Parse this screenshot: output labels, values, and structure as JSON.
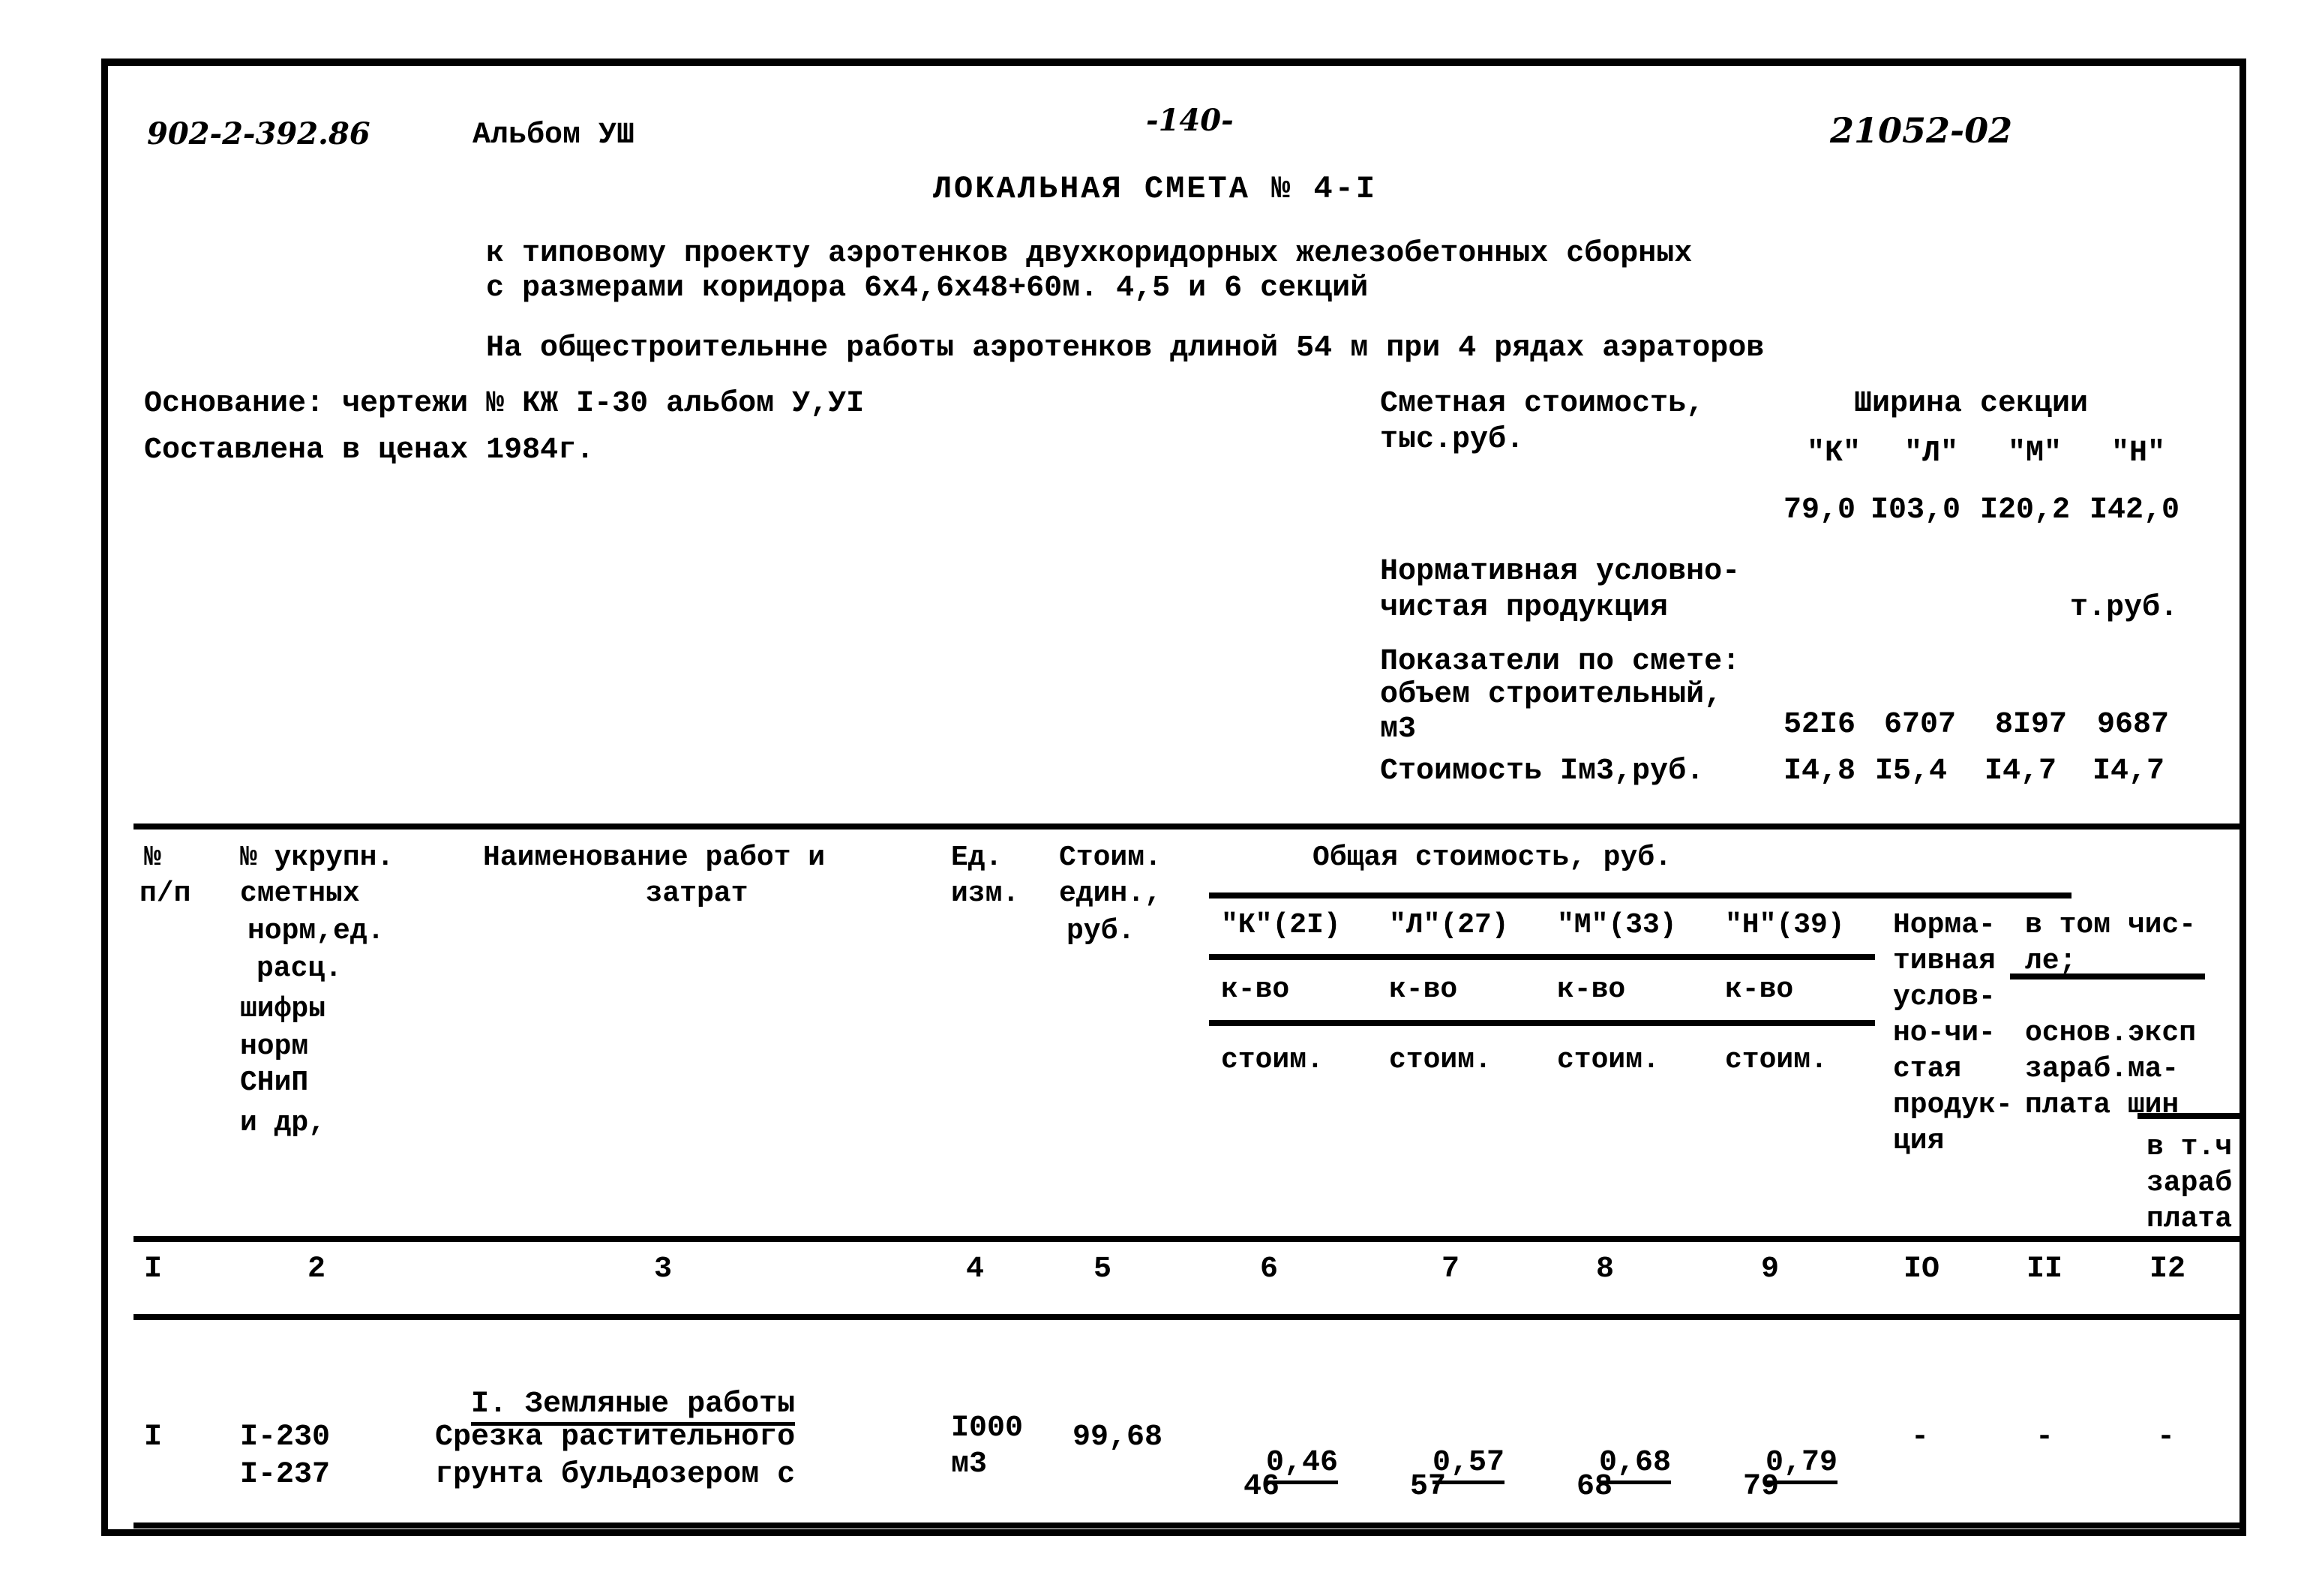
{
  "page": {
    "doc_code": "902-2-392.86",
    "album": "Альбом УШ",
    "page_number": "-140-",
    "sheet_code": "21052-02"
  },
  "header": {
    "title": "ЛОКАЛЬНАЯ СМЕТА № 4-I",
    "subtitle_line1": "к типовому проекту аэротенков двухкоридорных железобетонных сборных",
    "subtitle_line2": "с размерами коридора 6х4,6х48+60м. 4,5 и 6 секций",
    "subtitle_line3": "На общестроительнне работы аэротенков длиной 54 м при 4 рядах аэраторов"
  },
  "basis": {
    "line1": "Основание: чертежи № КЖ I-30 альбом У,УI",
    "line2": "Составлена в ценах 1984г."
  },
  "summary": {
    "estimate_cost_label_1": "Сметная стоимость,",
    "estimate_cost_label_2": "тыс.руб.",
    "section_width_title": "Ширина секции",
    "section_codes": [
      "\"К\"",
      "\"Л\"",
      "\"М\"",
      "\"Н\""
    ],
    "section_widths": [
      "79,0",
      "I03,0",
      "I20,2",
      "I42,0"
    ],
    "npp_label_1": "Нормативная условно-",
    "npp_label_2": "чистая продукция",
    "npp_units": "т.руб.",
    "indicators_label": "Показатели по смете:",
    "volume_label_1": "объем строительный,",
    "volume_label_2": "м3",
    "volumes": [
      "52I6",
      "6707",
      "8I97",
      "9687"
    ],
    "unit_cost_label": "Стоимость Iм3,руб.",
    "unit_costs": [
      "I4,8",
      "I5,4",
      "I4,7",
      "I4,7"
    ]
  },
  "table": {
    "col1_header": [
      "№",
      "п/п"
    ],
    "col2_header": [
      "№ укрупн.",
      "сметных",
      "норм,ед.",
      "расц.",
      "шифры",
      "норм",
      "СНиП",
      "и др,"
    ],
    "col3_header": [
      "Наименование работ и",
      "затрат"
    ],
    "col4_header": [
      "Ед.",
      "изм."
    ],
    "col5_header": [
      "Стоим.",
      "един.,",
      "руб."
    ],
    "group_header": "Общая стоимость, руб.",
    "section_cols": [
      "\"К\"(2I)",
      "\"Л\"(27)",
      "\"М\"(33)",
      "\"Н\"(39)"
    ],
    "qty_label": "к-во",
    "cost_label": "стоим.",
    "col10_header": [
      "Норма-",
      "тивная",
      "услов-",
      "но-чи-",
      "стая",
      "продук-",
      "ция"
    ],
    "col11_header_top": [
      "в том чис-",
      "ле;"
    ],
    "col11_header_body": [
      "основ.эксп",
      "зараб.ма-",
      "плата шин"
    ],
    "col12_header": [
      "в т.ч",
      "зараб",
      "плата"
    ],
    "numbering": [
      "I",
      "2",
      "3",
      "4",
      "5",
      "6",
      "7",
      "8",
      "9",
      "IO",
      "II",
      "I2"
    ],
    "section_title": "I. Земляные работы",
    "rows": [
      {
        "num": "I",
        "codes": [
          "I-230",
          "I-237"
        ],
        "name": [
          "Срезка растительного",
          "грунта бульдозером с"
        ],
        "unit": [
          "I000",
          "м3"
        ],
        "unit_cost": "99,68",
        "k_qty": "0,46",
        "k_cost": "46",
        "l_qty": "0,57",
        "l_cost": "57",
        "m_qty": "0,68",
        "m_cost": "68",
        "n_qty": "0,79",
        "n_cost": "79",
        "col10": "-",
        "col11": "-",
        "col12": "-"
      }
    ]
  }
}
